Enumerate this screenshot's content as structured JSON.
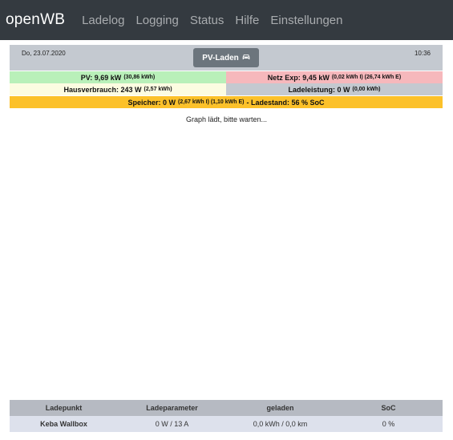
{
  "navbar": {
    "brand": "openWB",
    "items": [
      "Ladelog",
      "Logging",
      "Status",
      "Hilfe",
      "Einstellungen"
    ]
  },
  "info": {
    "date": "Do, 23.07.2020",
    "time": "10:36",
    "mode_label": "PV-Laden",
    "mode_icon": "car-icon"
  },
  "stats": {
    "pv": {
      "label": "PV: 9,69 kW",
      "detail": "(30,86 kWh)"
    },
    "netz": {
      "label": "Netz Exp: 9,45 kW",
      "detail": "(0,02 kWh I) (26,74 kWh E)"
    },
    "haus": {
      "label": "Hausverbrauch: 243 W",
      "detail": "(2,57 kWh)"
    },
    "lade": {
      "label": "Ladeleistung: 0 W",
      "detail": "(0,00 kWh)"
    },
    "speicher": {
      "label": "Speicher: 0 W",
      "detail": "(2,67 kWh I) (1,10 kWh E)",
      "soc": "- Ladestand: 56 % SoC"
    }
  },
  "graph": {
    "loading": "Graph lädt, bitte warten..."
  },
  "table": {
    "headers": [
      "Ladepunkt",
      "Ladeparameter",
      "geladen",
      "SoC"
    ],
    "rows": [
      {
        "name": "Keba Wallbox",
        "params": "0 W / 13 A",
        "charged": "0,0 kWh / 0,0 km",
        "soc": "0 %"
      }
    ]
  },
  "colors": {
    "navbar": "#343a40",
    "pv": "#b9f0b9",
    "netz": "#f6b8bc",
    "haus": "#fcfce1",
    "lade": "#c4c9d0",
    "speicher": "#fcc12a",
    "ladepunkt_name": "#2a7a2a"
  }
}
